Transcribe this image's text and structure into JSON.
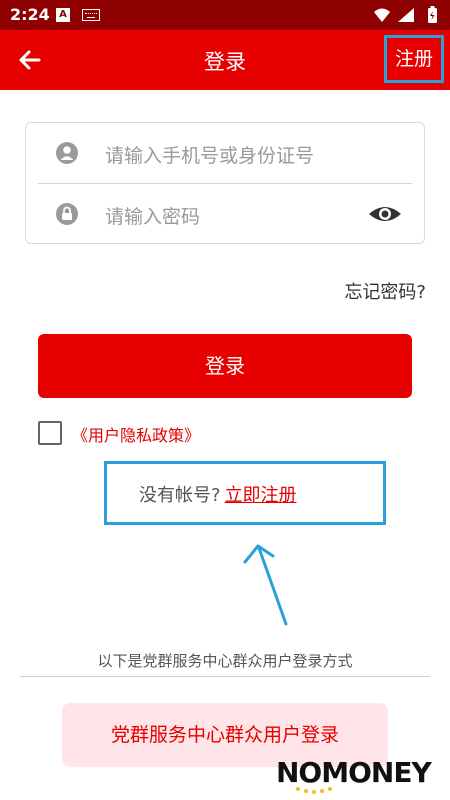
{
  "status": {
    "time": "2:24",
    "app_badge": "A"
  },
  "toolbar": {
    "title": "登录",
    "register": "注册"
  },
  "form": {
    "account_placeholder": "请输入手机号或身份证号",
    "password_placeholder": "请输入密码"
  },
  "forgot": "忘记密码?",
  "login_button": "登录",
  "policy": "《用户隐私政策》",
  "no_account": {
    "prefix": "没有帐号?",
    "link": "立即注册"
  },
  "alt_login": {
    "caption": "以下是党群服务中心群众用户登录方式",
    "button": "党群服务中心群众用户登录"
  },
  "watermark": "NOMONEY",
  "colors": {
    "primary": "#e60000",
    "status_bar": "#8f0000",
    "annotation": "#2aa0d8",
    "alt_bg": "#ffe5e7"
  }
}
